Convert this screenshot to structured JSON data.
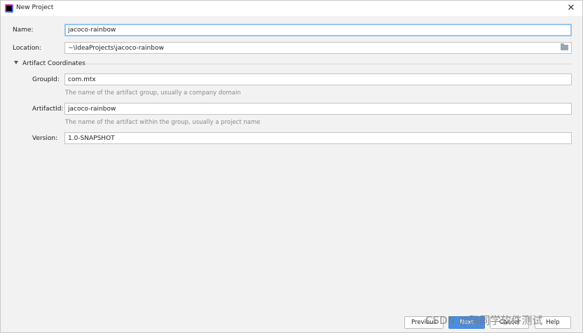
{
  "window": {
    "title": "New Project"
  },
  "form": {
    "name": {
      "label": "Name:",
      "value": "jacoco-rainbow"
    },
    "location": {
      "label": "Location:",
      "value": "~\\IdeaProjects\\jacoco-rainbow"
    }
  },
  "artifact": {
    "section_label": "Artifact Coordinates",
    "group_id": {
      "label": "GroupId:",
      "value": "com.mtx",
      "hint": "The name of the artifact group, usually a company domain"
    },
    "artifact_id": {
      "label": "ArtifactId:",
      "value": "jacoco-rainbow",
      "hint": "The name of the artifact within the group, usually a project name"
    },
    "version": {
      "label": "Version:",
      "value": "1.0-SNAPSHOT"
    }
  },
  "buttons": {
    "previous": "Previous",
    "next": "Next",
    "cancel": "Cancel",
    "help": "Help"
  },
  "watermark": "CSDN @码同学软件测试"
}
